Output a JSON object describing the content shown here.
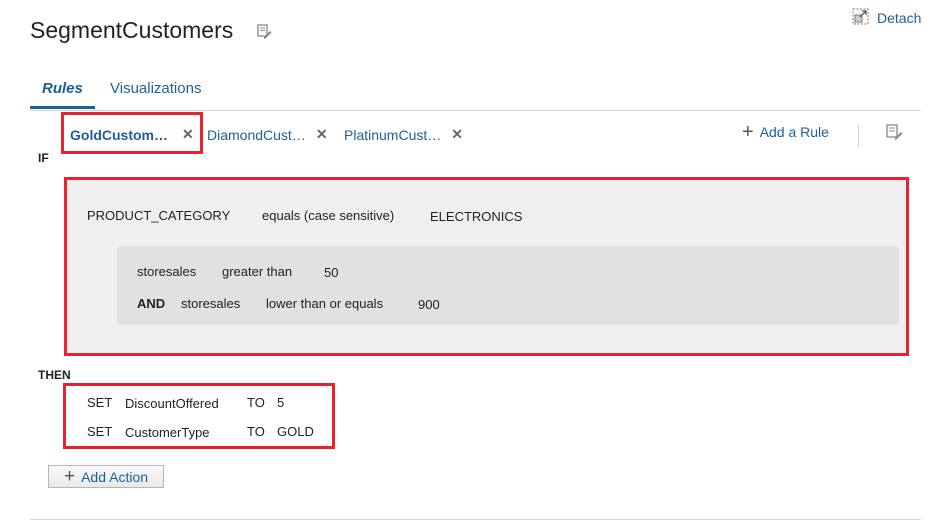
{
  "header": {
    "title": "SegmentCustomers",
    "detach_label": "Detach"
  },
  "tabs": {
    "rules": "Rules",
    "visualizations": "Visualizations"
  },
  "rule_tabs": [
    {
      "label": "GoldCustom…",
      "close": "✕"
    },
    {
      "label": "DiamondCust…",
      "close": "✕"
    },
    {
      "label": "PlatinumCust…",
      "close": "✕"
    }
  ],
  "toolbar": {
    "add_rule_label": "Add a Rule",
    "add_rule_icon": "+"
  },
  "rule": {
    "if_label": "IF",
    "condition": {
      "field": "PRODUCT_CATEGORY",
      "operator": "equals (case sensitive)",
      "value": "ELECTRONICS"
    },
    "nested": [
      {
        "connector": "",
        "field": "storesales",
        "operator": "greater than",
        "value": "50"
      },
      {
        "connector": "AND",
        "field": "storesales",
        "operator": "lower than or equals",
        "value": "900"
      }
    ],
    "then_label": "THEN",
    "actions": [
      {
        "set": "SET",
        "target": "DiscountOffered",
        "to": "TO",
        "value": "5"
      },
      {
        "set": "SET",
        "target": "CustomerType",
        "to": "TO",
        "value": "GOLD"
      }
    ],
    "add_action_label": "Add Action",
    "add_action_icon": "+"
  },
  "colors": {
    "accent": "#1f5e97",
    "highlight": "#e8222f",
    "panel": "#efefef",
    "inner_panel": "#e1e1e1"
  }
}
